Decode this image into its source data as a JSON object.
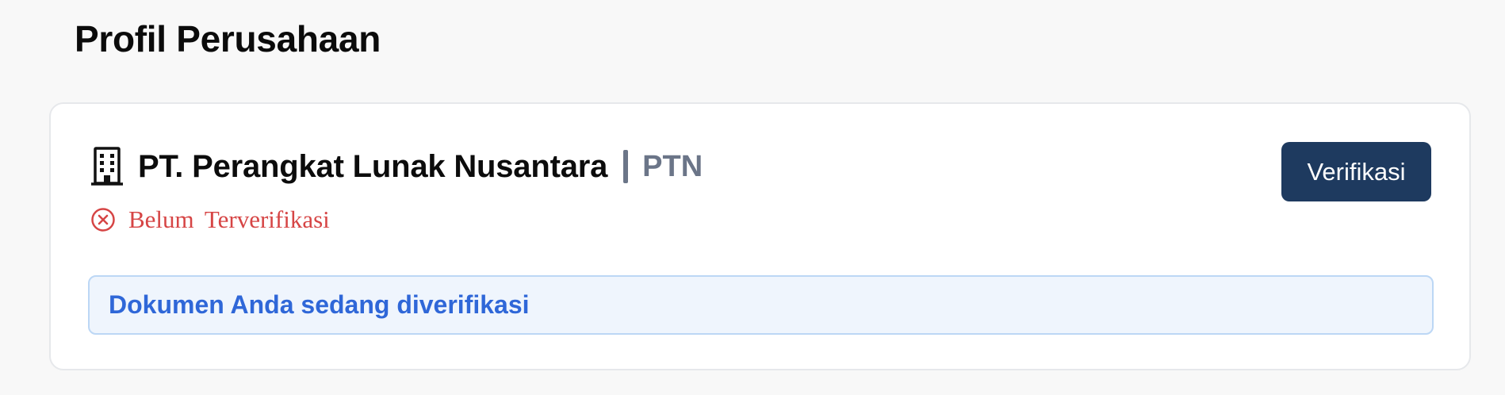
{
  "page": {
    "title": "Profil Perusahaan"
  },
  "company": {
    "icon": "building-icon",
    "name": "PT. Perangkat Lunak Nusantara",
    "separator": "|",
    "code": "PTN"
  },
  "status": {
    "icon": "x-circle-icon",
    "text": "Belum Terverifikasi",
    "color": "#d64545"
  },
  "actions": {
    "verify_label": "Verifikasi",
    "verify_color": "#1e3a5f"
  },
  "banner": {
    "text": "Dokumen Anda sedang diverifikasi",
    "text_color": "#2f67d8",
    "background": "#eff5fd"
  }
}
